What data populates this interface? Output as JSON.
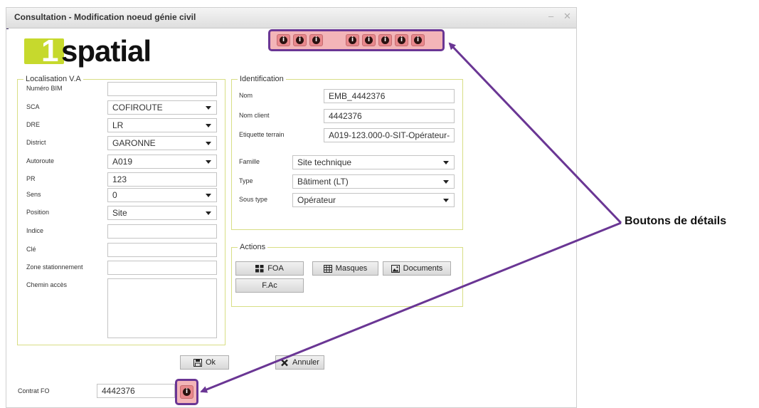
{
  "window": {
    "title": "Consultation - Modification noeud génie civil",
    "minimize_glyph": "–",
    "close_glyph": "✕"
  },
  "logo": {
    "one": "1",
    "word": "spatial"
  },
  "localisation": {
    "legend": "Localisation V.A",
    "fields": [
      {
        "label": "Numéro BIM",
        "type": "input",
        "value": ""
      },
      {
        "label": "SCA",
        "type": "select",
        "value": "COFIROUTE"
      },
      {
        "label": "DRE",
        "type": "select",
        "value": "LR"
      },
      {
        "label": "District",
        "type": "select",
        "value": "GARONNE"
      },
      {
        "label": "Autoroute",
        "type": "select",
        "value": "A019"
      },
      {
        "label": "PR",
        "type": "input",
        "value": "123"
      },
      {
        "label": "Sens",
        "type": "select",
        "value": "0"
      },
      {
        "label": "Position",
        "type": "select",
        "value": "Site"
      },
      {
        "label": "Indice",
        "type": "input",
        "value": ""
      },
      {
        "label": "Clé",
        "type": "input",
        "value": ""
      },
      {
        "label": "Zone stationnement",
        "type": "input",
        "value": ""
      },
      {
        "label": "Chemin accès",
        "type": "textarea",
        "value": ""
      }
    ]
  },
  "identification": {
    "legend": "Identification",
    "fields": [
      {
        "label": "Nom",
        "type": "input",
        "value": "EMB_4442376"
      },
      {
        "label": "Nom client",
        "type": "input",
        "value": "4442376"
      },
      {
        "label": "Etiquette terrain",
        "type": "input",
        "value": "A019-123.000-0-SIT-Opérateur-"
      },
      {
        "label": "Famille",
        "type": "select",
        "value": "Site technique"
      },
      {
        "label": "Type",
        "type": "select",
        "value": "Bâtiment (LT)"
      },
      {
        "label": "Sous type",
        "type": "select",
        "value": "Opérateur"
      }
    ]
  },
  "actions": {
    "legend": "Actions",
    "buttons": [
      {
        "label": "FOA",
        "icon": "grid-icon"
      },
      {
        "label": "Masques",
        "icon": "table-icon"
      },
      {
        "label": "Documents",
        "icon": "image-icon"
      },
      {
        "label": "F.Ac",
        "icon": ""
      }
    ]
  },
  "footer": {
    "ok_label": "Ok",
    "cancel_label": "Annuler"
  },
  "contrat": {
    "label": "Contrat FO",
    "value": "4442376"
  },
  "info_glyph": "i",
  "annotation": {
    "callout": "Boutons de détails",
    "highlight_color": "#f3b5b8",
    "border_color": "#6a3694"
  },
  "colors": {
    "fieldset_border": "#d8de85",
    "logo_green": "#c6d92d"
  }
}
